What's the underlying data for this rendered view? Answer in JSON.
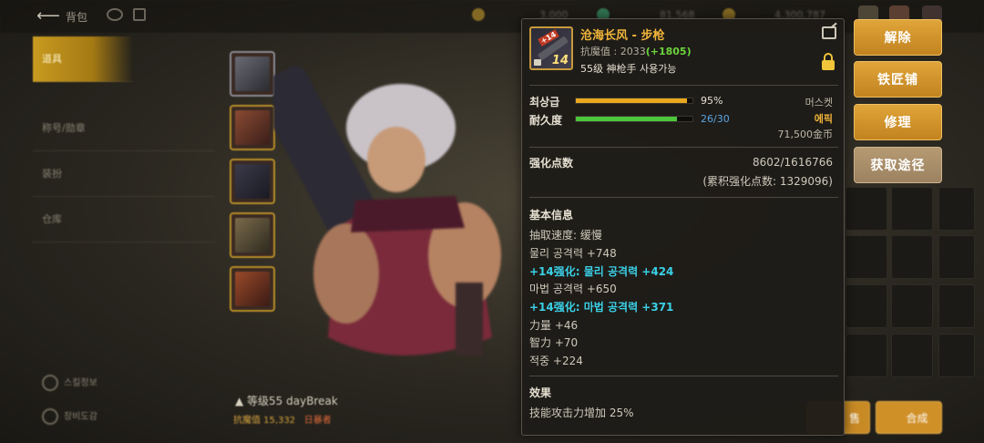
{
  "header": {
    "title": "背包",
    "currency": [
      "3,000",
      "81,568",
      "4,300,787"
    ]
  },
  "nav": {
    "items": [
      "道具",
      "称号/勋章",
      "装扮",
      "仓库"
    ],
    "bottom": [
      "스킬정보",
      "장비도감"
    ]
  },
  "character": {
    "name_line": "等级55 dayBreak",
    "anti_magic": "抗魔值 15,332",
    "extra": "日暴者"
  },
  "tooltip": {
    "item_name": "沧海长风 - 步枪",
    "item_plus": "14",
    "anti_magic_label": "抗魔值 : 2033",
    "anti_magic_bonus": "(+1805)",
    "requirement": "55级 神枪手 사용가능",
    "grade_label": "최상급",
    "grade_value": "95%",
    "grade_percent": 95,
    "durability_label": "耐久度",
    "durability_value": "26/30",
    "durability_percent": 86.7,
    "item_type": "머스켓",
    "rarity": "에픽",
    "price": "71,500金币",
    "reinforce_label": "强化点数",
    "reinforce_value": "8602/1616766",
    "reinforce_total": "(累积强化点数: 1329096)",
    "basic_title": "基本信息",
    "stats": [
      {
        "text": "抽取速度:  缓慢",
        "highlight": false
      },
      {
        "text": "물리 공격력 +748",
        "highlight": false
      },
      {
        "text": "+14强化:  물리 공격력 +424",
        "highlight": true
      },
      {
        "text": "마법 공격력 +650",
        "highlight": false
      },
      {
        "text": "+14强化:  마법 공격력 +371",
        "highlight": true
      },
      {
        "text": "力量 +46",
        "highlight": false
      },
      {
        "text": "智力 +70",
        "highlight": false
      },
      {
        "text": "적중 +224",
        "highlight": false
      }
    ],
    "effect_title": "效果",
    "effect_text": "技能攻击力增加 25%"
  },
  "actions": {
    "unequip": "解除",
    "blacksmith": "铁匠铺",
    "repair": "修理",
    "obtain": "获取途径"
  },
  "bottom_buttons": [
    "售",
    "合成"
  ],
  "colors": {
    "gold": "#f0b43a",
    "cyan": "#3ad0e6",
    "green": "#6cd43c",
    "grade_bar": "#e9a81e",
    "durability_bar": "#4cc63a"
  }
}
